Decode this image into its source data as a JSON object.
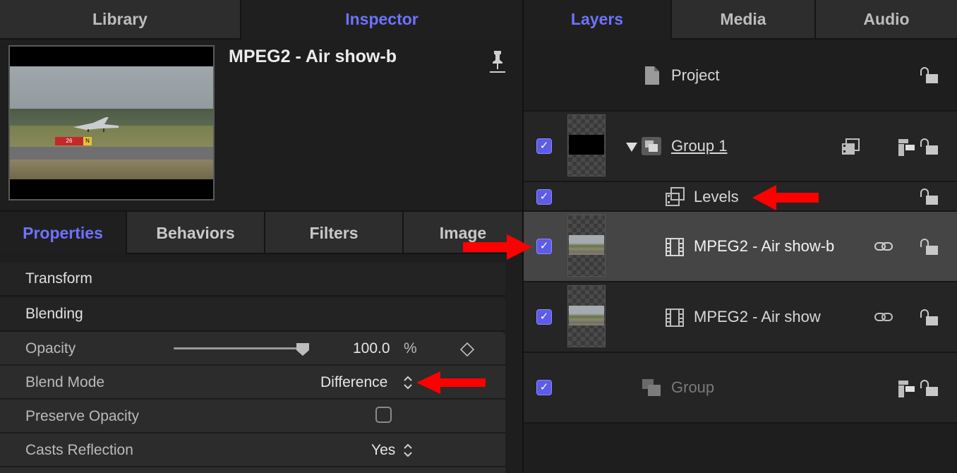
{
  "top_tabs": {
    "library": "Library",
    "inspector": "Inspector",
    "layers": "Layers",
    "media": "Media",
    "audio": "Audio"
  },
  "inspector": {
    "clip_title": "MPEG2 - Air show-b",
    "preview_sign_text": "26",
    "preview_sign2_text": "N",
    "tabs": [
      "Properties",
      "Behaviors",
      "Filters",
      "Image"
    ],
    "sections": {
      "transform": "Transform",
      "blending": "Blending"
    },
    "rows": {
      "opacity": {
        "label": "Opacity",
        "value": "100.0",
        "unit": "%",
        "level": 1.0
      },
      "blend_mode": {
        "label": "Blend Mode",
        "value": "Difference"
      },
      "preserve_opacity": {
        "label": "Preserve Opacity",
        "checked": false
      },
      "casts_reflection": {
        "label": "Casts Reflection",
        "value": "Yes"
      }
    }
  },
  "layers": {
    "project": "Project",
    "group1": "Group 1",
    "levels": "Levels",
    "clip_b": "MPEG2 - Air show-b",
    "clip": "MPEG2 - Air show",
    "group": "Group"
  },
  "colors": {
    "accent": "#6f72ff",
    "checkbox": "#5e5ce6",
    "arrow": "#ff0000"
  },
  "icons": [
    "pin-icon",
    "document-icon",
    "group-icon",
    "filter-icon",
    "film-icon",
    "link-icon",
    "lock-icon",
    "layout-icon",
    "disclosure-triangle-icon",
    "keyframe-diamond-icon",
    "stepper-icon"
  ]
}
